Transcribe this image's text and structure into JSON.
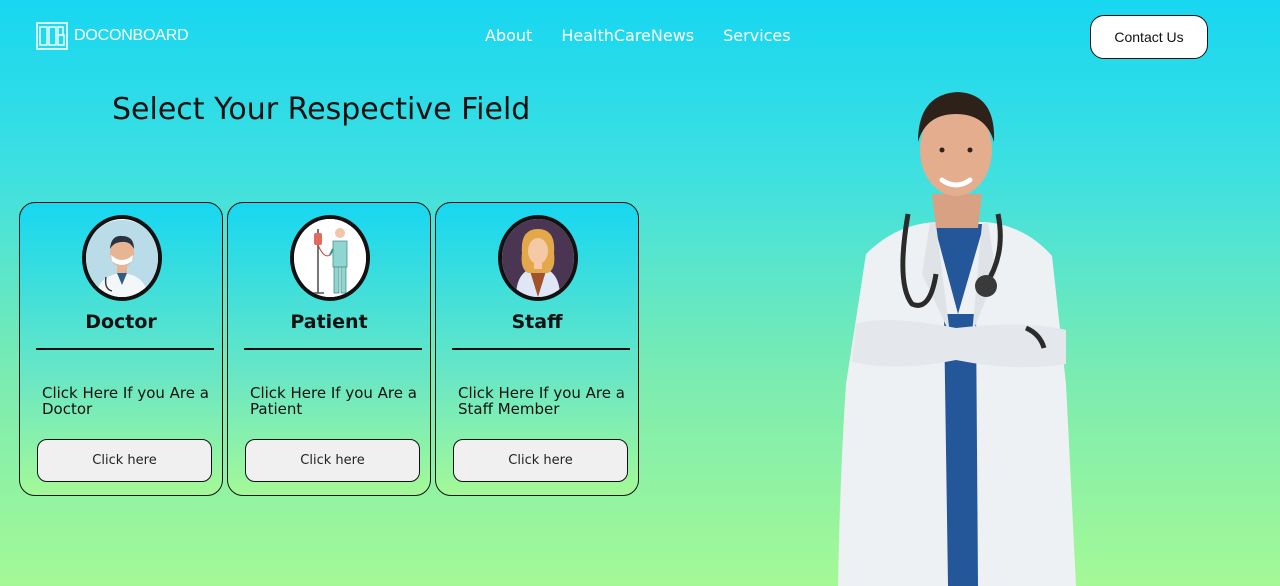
{
  "header": {
    "logo_text": "DOCONBOARD",
    "nav": [
      {
        "label": "About"
      },
      {
        "label": "HealthCareNews"
      },
      {
        "label": "Services"
      }
    ],
    "contact_label": "Contact Us"
  },
  "main": {
    "heading": "Select Your Respective Field",
    "cards": [
      {
        "title": "Doctor",
        "description": "Click Here If you Are a Doctor",
        "button": "Click here",
        "icon": "doctor-avatar-icon"
      },
      {
        "title": "Patient",
        "description": "Click Here If you Are a Patient",
        "button": "Click here",
        "icon": "patient-avatar-icon"
      },
      {
        "title": "Staff",
        "description": "Click Here If you Are a Staff Member",
        "button": "Click here",
        "icon": "staff-avatar-icon"
      }
    ]
  },
  "colors": {
    "gradient_top": "#17d7f1",
    "gradient_bottom": "#a4f996",
    "text": "#111111",
    "button_bg": "#f0f0f0"
  }
}
